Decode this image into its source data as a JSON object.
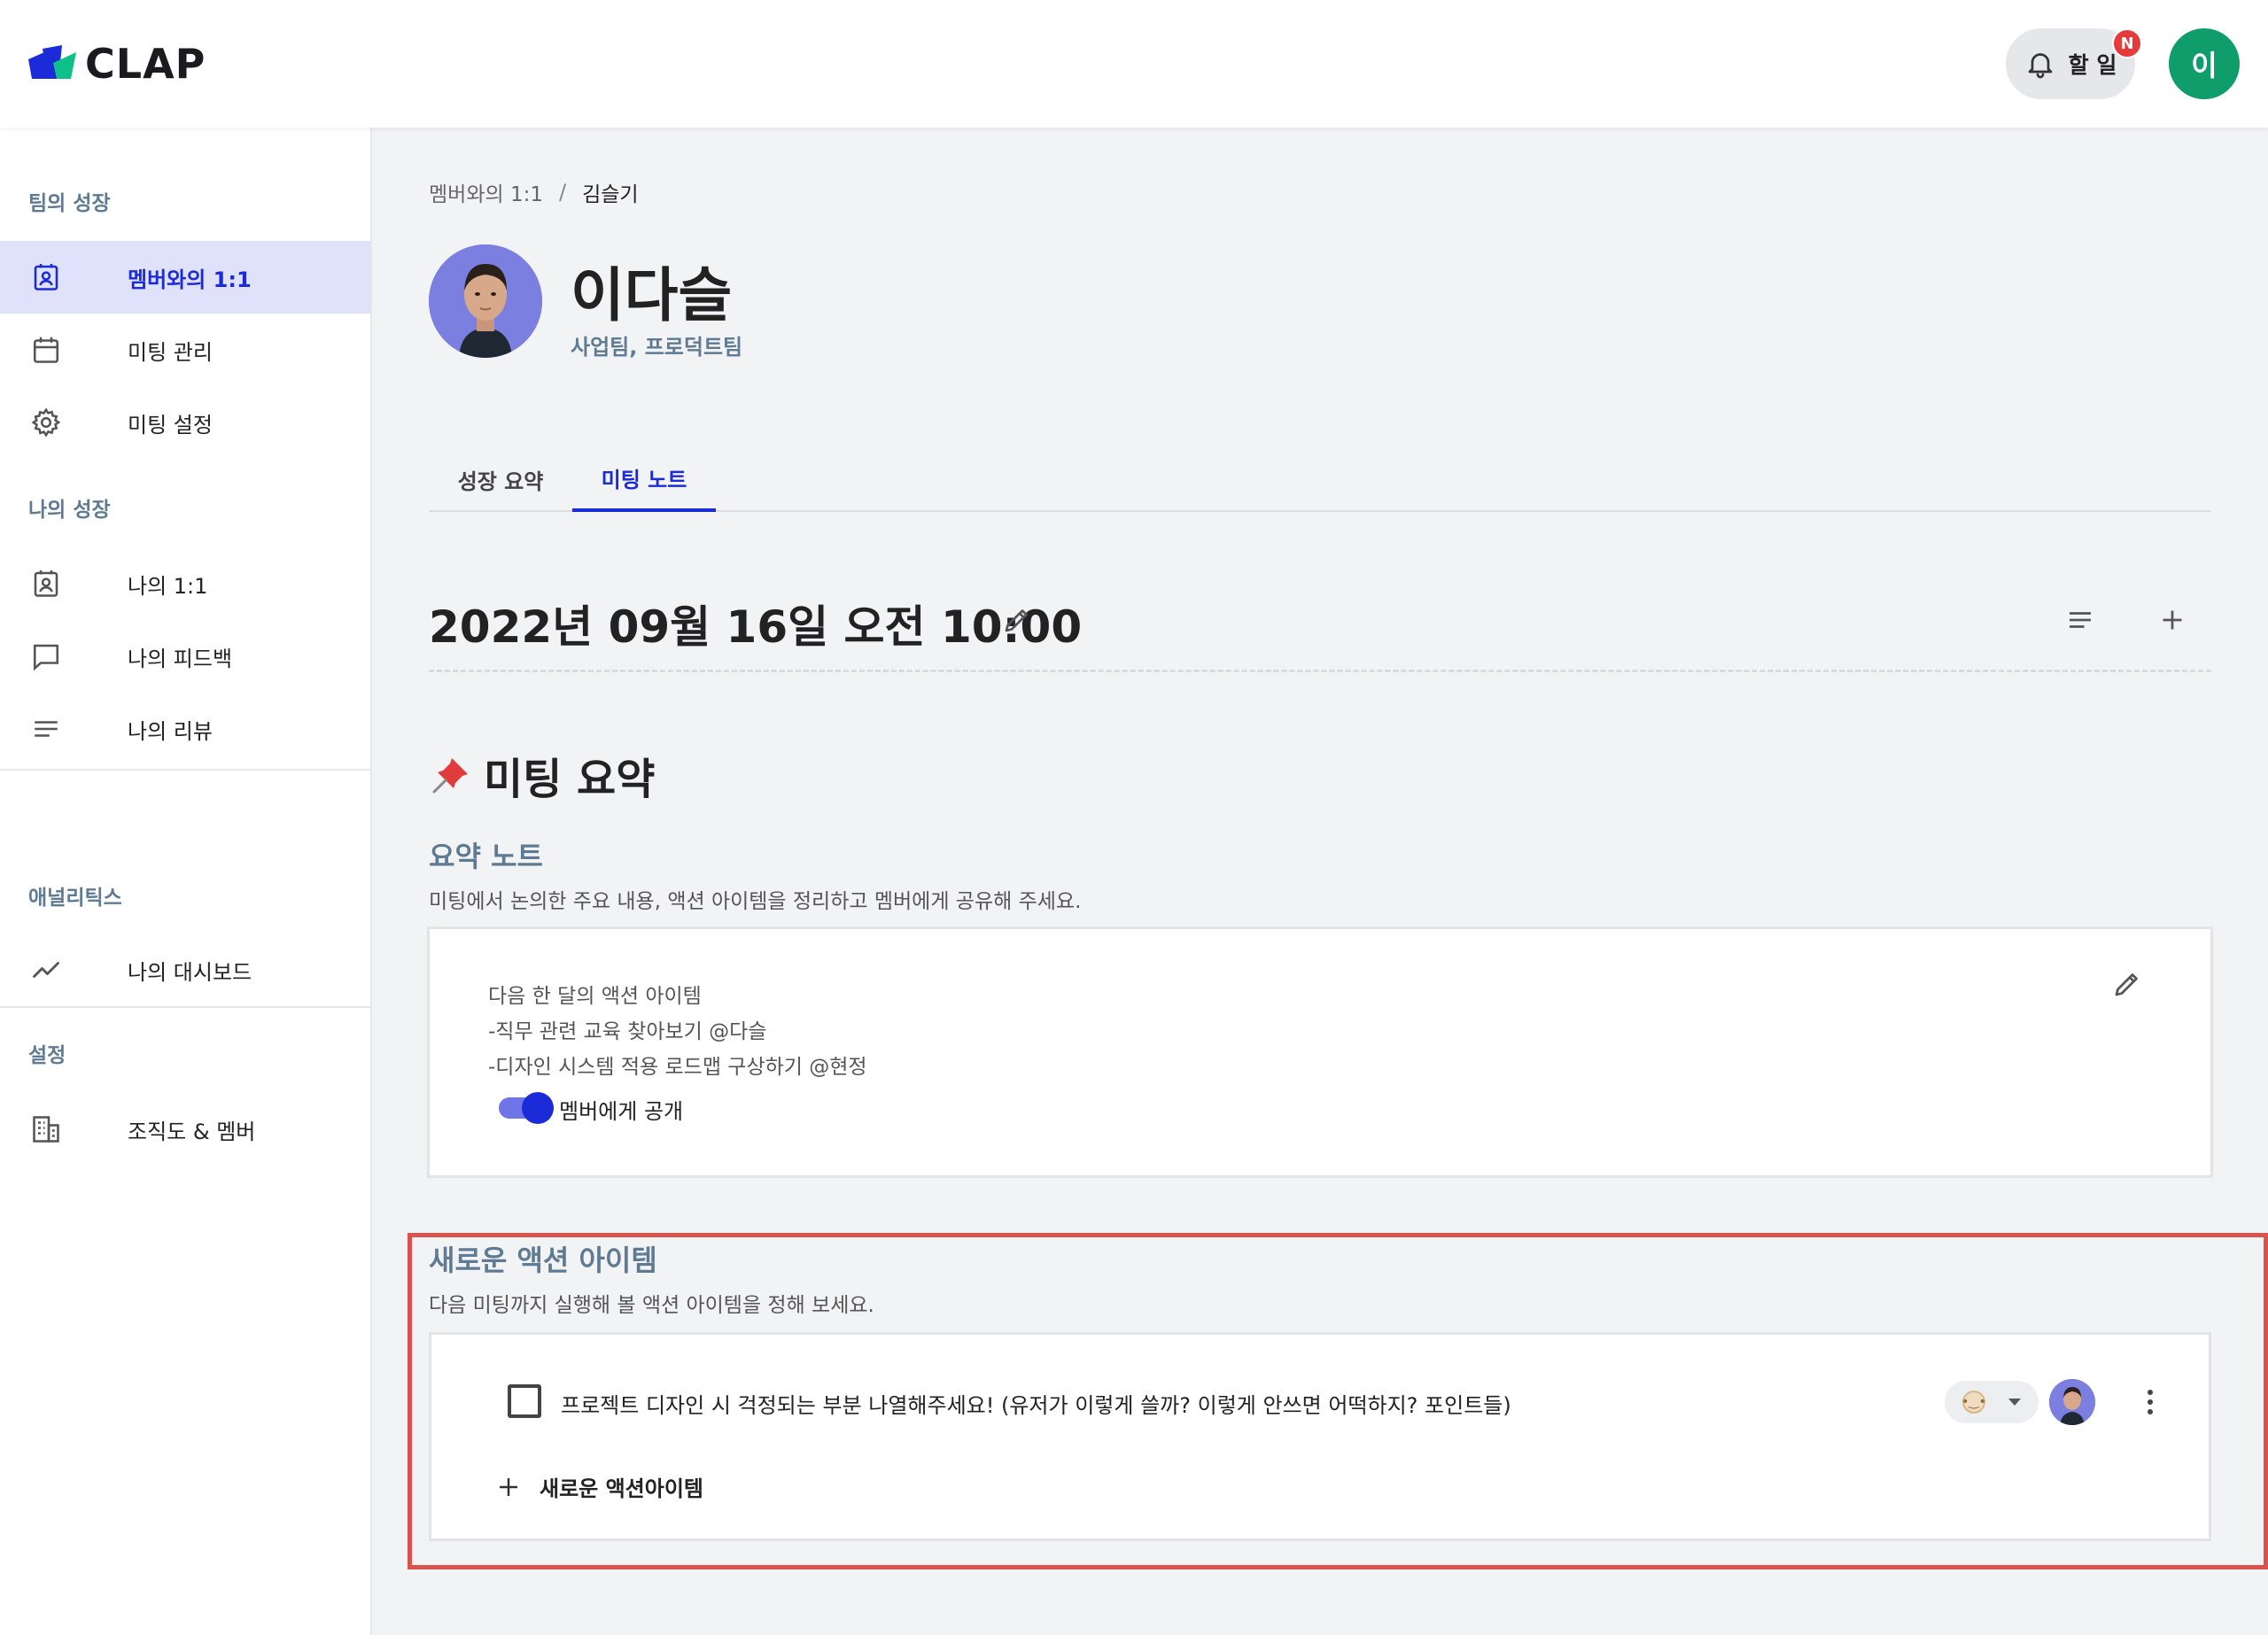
{
  "header": {
    "logo_text": "CLAP",
    "todo_label": "할 일",
    "todo_badge": "N",
    "user_initial": "이"
  },
  "sidebar": {
    "sections": [
      {
        "title": "팀의 성장"
      },
      {
        "title": "나의 성장"
      },
      {
        "title": "애널리틱스"
      },
      {
        "title": "설정"
      }
    ],
    "items": [
      {
        "label": "멤버와의 1:1",
        "icon": "contact-card-icon",
        "active": true
      },
      {
        "label": "미팅 관리",
        "icon": "calendar-icon",
        "active": false
      },
      {
        "label": "미팅 설정",
        "icon": "gear-icon",
        "active": false
      },
      {
        "label": "나의 1:1",
        "icon": "contact-card-icon",
        "active": false
      },
      {
        "label": "나의 피드백",
        "icon": "chat-bubble-icon",
        "active": false
      },
      {
        "label": "나의 리뷰",
        "icon": "lines-icon",
        "active": false
      },
      {
        "label": "나의 대시보드",
        "icon": "trend-icon",
        "active": false
      },
      {
        "label": "조직도 & 멤버",
        "icon": "building-icon",
        "active": false
      }
    ]
  },
  "breadcrumb": {
    "parent": "멤버와의 1:1",
    "separator": "/",
    "current": "김슬기"
  },
  "profile": {
    "name": "이다슬",
    "teams": "사업팀, 프로덕트팀"
  },
  "tabs": [
    {
      "label": "성장 요약",
      "active": false
    },
    {
      "label": "미팅 노트",
      "active": true
    }
  ],
  "meeting": {
    "datetime": "2022년 09월 16일 오전 10:00"
  },
  "summary": {
    "heading": "미팅 요약",
    "note_title": "요약 노트",
    "note_desc": "미팅에서 논의한 주요 내용, 액션 아이템을 정리하고 멤버에게 공유해 주세요.",
    "note_lines": [
      "다음 한 달의 액션 아이템",
      "-직무 관련 교육 찾아보기  @다슬",
      "-디자인 시스템 적용 로드맵 구상하기 @현정"
    ],
    "share_label": "멤버에게 공개",
    "share_on": true
  },
  "actions": {
    "title": "새로운 액션 아이템",
    "desc": "다음 미팅까지 실행해 볼 액션 아이템을 정해 보세요.",
    "items": [
      {
        "text": "프로젝트 디자인 시 걱정되는 부분 나열해주세요! (유저가 이렇게 쓸까? 이렇게 안쓰면 어떡하지? 포인트들)",
        "checked": false
      }
    ],
    "add_label": "새로운 액션아이템"
  },
  "colors": {
    "accent": "#1b2bd8",
    "active_bg": "#e0e1fb",
    "section_title": "#5f7a93",
    "avatar_green": "#0f9d6b",
    "badge_red": "#e63b3b",
    "highlight_red": "#d9534f"
  }
}
